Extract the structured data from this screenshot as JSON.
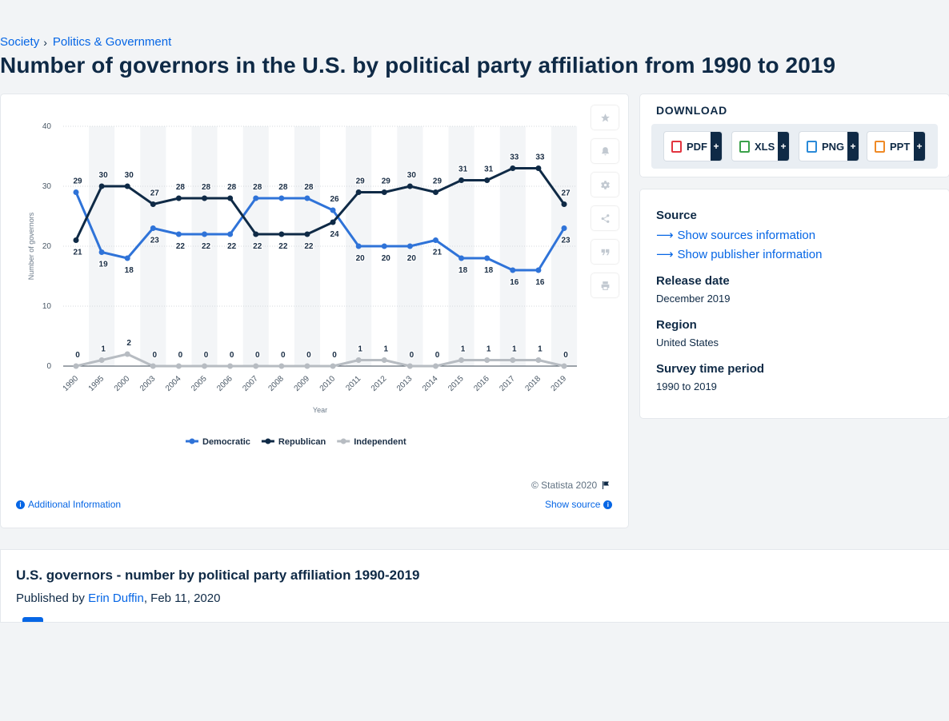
{
  "breadcrumb": {
    "item1": "Society",
    "separator": "›",
    "item2": "Politics & Government"
  },
  "page_title": "Number of governors in the U.S. by political party affiliation from 1990 to 2019",
  "chart_footer": {
    "copyright": "© Statista 2020",
    "additional_info": "Additional Information",
    "show_source": "Show source"
  },
  "download": {
    "title": "DOWNLOAD",
    "buttons": [
      {
        "label": "PDF",
        "color": "#e2343f"
      },
      {
        "label": "XLS",
        "color": "#3aa14a"
      },
      {
        "label": "PNG",
        "color": "#2a8ad8"
      },
      {
        "label": "PPT",
        "color": "#ef8a26"
      }
    ],
    "plus": "+"
  },
  "info": {
    "source_label": "Source",
    "show_sources": "Show sources information",
    "show_publisher": "Show publisher information",
    "release_label": "Release date",
    "release_value": "December 2019",
    "region_label": "Region",
    "region_value": "United States",
    "period_label": "Survey time period",
    "period_value": "1990 to 2019"
  },
  "article": {
    "title": "U.S. governors - number by political party affiliation 1990-2019",
    "published_prefix": "Published by ",
    "author": "Erin Duffin",
    "date": ", Feb 11, 2020"
  },
  "tools": [
    "star-icon",
    "bell-icon",
    "gear-icon",
    "share-icon",
    "quote-icon",
    "print-icon"
  ],
  "chart_data": {
    "type": "line",
    "categories": [
      "1990",
      "1995",
      "2000",
      "2003",
      "2004",
      "2005",
      "2006",
      "2007",
      "2008",
      "2009",
      "2010",
      "2011",
      "2012",
      "2013",
      "2014",
      "2015",
      "2016",
      "2017",
      "2018",
      "2019"
    ],
    "series": [
      {
        "name": "Democratic",
        "color": "#2f73d8",
        "values": [
          29,
          19,
          18,
          23,
          22,
          22,
          22,
          28,
          28,
          28,
          26,
          20,
          20,
          20,
          21,
          18,
          18,
          16,
          16,
          23
        ]
      },
      {
        "name": "Republican",
        "color": "#0f2a46",
        "values": [
          21,
          30,
          30,
          27,
          28,
          28,
          28,
          22,
          22,
          22,
          24,
          29,
          29,
          30,
          29,
          31,
          31,
          33,
          33,
          27
        ]
      },
      {
        "name": "Independent",
        "color": "#b7bcc2",
        "values": [
          0,
          1,
          2,
          0,
          0,
          0,
          0,
          0,
          0,
          0,
          0,
          1,
          1,
          0,
          0,
          1,
          1,
          1,
          1,
          0
        ]
      }
    ],
    "xlabel": "Year",
    "ylabel": "Number of governors",
    "ylim": [
      0,
      40
    ],
    "yticks": [
      0,
      10,
      20,
      30,
      40
    ],
    "grid": true,
    "legend_position": "bottom"
  }
}
